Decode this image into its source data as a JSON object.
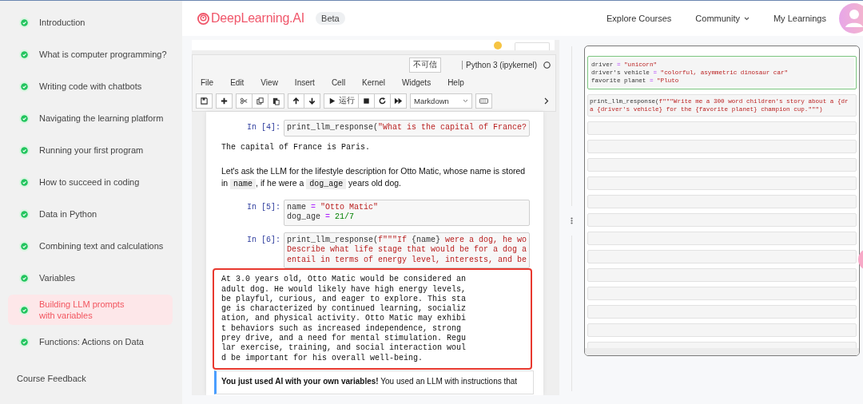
{
  "sidebar": {
    "lessons": [
      {
        "title": "Introduction",
        "completed": true,
        "selected": false
      },
      {
        "title": "What is computer programming?",
        "completed": true,
        "selected": false
      },
      {
        "title": "Writing code with chatbots",
        "completed": true,
        "selected": false
      },
      {
        "title": "Navigating the learning platform",
        "completed": true,
        "selected": false
      },
      {
        "title": "Running your first program",
        "completed": true,
        "selected": false
      },
      {
        "title": "How to succeed in coding",
        "completed": true,
        "selected": false
      },
      {
        "title": "Data in Python",
        "completed": true,
        "selected": false
      },
      {
        "title": "Combining text and calculations",
        "completed": true,
        "selected": false
      },
      {
        "title": "Variables",
        "completed": true,
        "selected": false
      },
      {
        "title": "Building LLM prompts\nwith variables",
        "completed": true,
        "selected": true
      },
      {
        "title": "Functions: Actions on Data",
        "completed": true,
        "selected": false
      }
    ],
    "links": [
      "Course Feedback"
    ]
  },
  "header": {
    "brand": "DeepLearning.AI",
    "badge": "Beta",
    "nav": [
      {
        "label": "Explore Courses",
        "dropdown": false
      },
      {
        "label": "Community",
        "dropdown": true
      },
      {
        "label": "My Learnings",
        "dropdown": false
      }
    ]
  },
  "notebook": {
    "trust": "不可信",
    "kernel": "Python 3 (ipykernel)",
    "menu": [
      "File",
      "Edit",
      "View",
      "Insert",
      "Cell",
      "Kernel",
      "Widgets",
      "Help"
    ],
    "toolbar": [
      [
        {
          "kind": "save"
        }
      ],
      [
        {
          "kind": "add"
        }
      ],
      [
        {
          "kind": "cut"
        },
        {
          "kind": "copy"
        },
        {
          "kind": "paste"
        }
      ],
      [
        {
          "kind": "up"
        },
        {
          "kind": "down"
        }
      ],
      [
        {
          "kind": "run",
          "label": "运行"
        },
        {
          "kind": "stop"
        },
        {
          "kind": "restart"
        },
        {
          "kind": "run-all"
        }
      ],
      [
        {
          "kind": "select",
          "value": "Markdown"
        }
      ],
      [
        {
          "kind": "keyboard"
        }
      ]
    ],
    "cells": [
      {
        "kind": "code",
        "prompt": "In [4]:",
        "lines": [
          [
            {
              "text": "print_llm_response(",
              "kind": "plain"
            },
            {
              "text": "\"What is the capital of France?",
              "kind": "string"
            }
          ]
        ]
      },
      {
        "kind": "output",
        "highlighted": false,
        "lines": [
          "The capital of France is Paris."
        ]
      },
      {
        "kind": "markdown",
        "segments": [
          {
            "text": "Let's ask the LLM for the lifestyle description for Otto Matic, whose name is stored in ",
            "kind": "prose"
          },
          {
            "text": "name",
            "kind": "inline-code"
          },
          {
            "text": ", if he were a ",
            "kind": "prose"
          },
          {
            "text": "dog_age",
            "kind": "inline-code"
          },
          {
            "text": " years old dog.",
            "kind": "prose"
          }
        ]
      },
      {
        "kind": "code",
        "prompt": "In [5]:",
        "lines": [
          [
            {
              "text": "name ",
              "kind": "plain"
            },
            {
              "text": "=",
              "kind": "operator"
            },
            {
              "text": " \"Otto Matic\"",
              "kind": "string"
            }
          ],
          [
            {
              "text": "dog_age ",
              "kind": "plain"
            },
            {
              "text": "=",
              "kind": "operator"
            },
            {
              "text": " 21/7",
              "kind": "number"
            }
          ]
        ]
      },
      {
        "kind": "code",
        "prompt": "In [6]:",
        "lines": [
          [
            {
              "text": "print_llm_response(",
              "kind": "plain"
            },
            {
              "text": "f\"\"\"If ",
              "kind": "string"
            },
            {
              "text": "{name}",
              "kind": "plain"
            },
            {
              "text": " were a dog, he wo",
              "kind": "string"
            }
          ],
          [
            {
              "text": "Describe what life stage that would be for a dog a",
              "kind": "string"
            }
          ],
          [
            {
              "text": "entail in terms of energy level, interests, and be",
              "kind": "string"
            }
          ]
        ]
      },
      {
        "kind": "output",
        "highlighted": true,
        "lines": [
          "At 3.0 years old, Otto Matic would be considered an",
          "adult dog. He would likely have high energy levels,",
          "be playful, curious, and eager to explore. This sta",
          "ge is characterized by continued learning, socializ",
          "ation, and physical activity. Otto Matic may exhibi",
          "t behaviors such as increased independence, strong",
          "prey drive, and a need for mental stimulation. Regu",
          "lar exercise, training, and social interaction woul",
          "d be important for his overall well-being."
        ]
      },
      {
        "kind": "callout",
        "text": "**You just used AI with your own variables!** You used an LLM with instructions that"
      }
    ]
  },
  "scratchpad": {
    "cells": [
      {
        "kind": "code",
        "selected": true,
        "lines": [
          [
            {
              "text": "driver ",
              "kind": "plain"
            },
            {
              "text": "=",
              "kind": "operator"
            },
            {
              "text": " \"unicorn\"",
              "kind": "string"
            }
          ],
          [
            {
              "text": "driver's vehicle ",
              "kind": "plain"
            },
            {
              "text": "=",
              "kind": "operator"
            },
            {
              "text": " \"colorful, asymmetric dinosaur car\"",
              "kind": "string"
            }
          ],
          [
            {
              "text": "favorite planet ",
              "kind": "plain"
            },
            {
              "text": "=",
              "kind": "operator"
            },
            {
              "text": " \"Pluto",
              "kind": "string"
            }
          ]
        ]
      },
      {
        "kind": "code",
        "selected": false,
        "lines": [
          [
            {
              "text": "print_llm_response(",
              "kind": "plain"
            },
            {
              "text": "f\"\"\"Write me a 300 word children's story about a {dr",
              "kind": "string"
            }
          ],
          [
            {
              "text": "a {driver's vehicle} for the {favorite planet} champion cup.\"\"\")",
              "kind": "string"
            }
          ]
        ]
      },
      {
        "kind": "empty",
        "selected": false
      },
      {
        "kind": "empty",
        "selected": false
      },
      {
        "kind": "empty",
        "selected": false
      },
      {
        "kind": "empty",
        "selected": false
      },
      {
        "kind": "empty",
        "selected": false
      },
      {
        "kind": "empty",
        "selected": false
      },
      {
        "kind": "empty",
        "selected": false
      },
      {
        "kind": "empty",
        "selected": false
      },
      {
        "kind": "empty",
        "selected": false
      },
      {
        "kind": "empty",
        "selected": false
      },
      {
        "kind": "empty",
        "selected": false
      },
      {
        "kind": "empty",
        "selected": false
      },
      {
        "kind": "empty",
        "selected": false
      }
    ]
  }
}
